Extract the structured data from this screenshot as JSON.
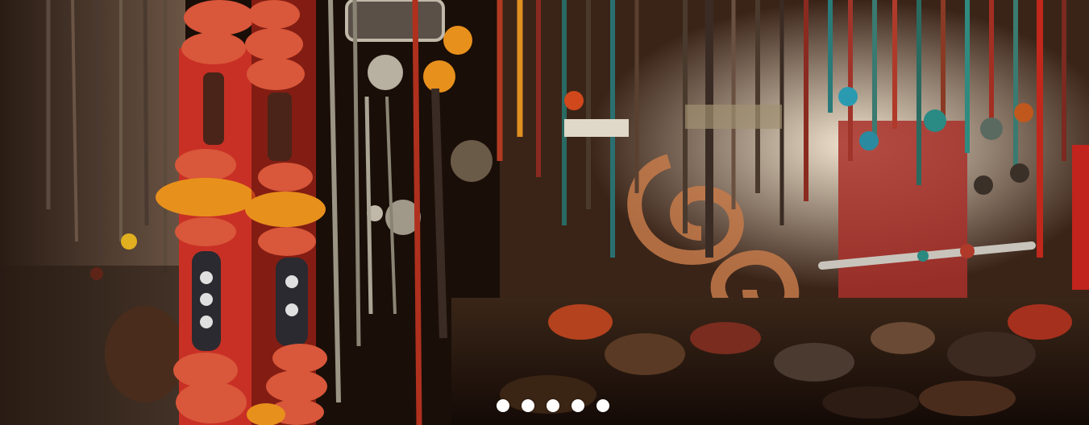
{
  "slider": {
    "slide_count": 5,
    "active_index": 0,
    "dot_color": "#ffffff"
  },
  "scene": {
    "palette": {
      "background": "#1a0e08",
      "bead_red": "#c8321e",
      "bead_orange": "#e8901c",
      "bead_coral": "#d9573a",
      "turquoise": "#1f8a8a",
      "silver": "#b8b0a0",
      "wall": "#e8d8c0",
      "swirl": "#c57a4a",
      "cloth_red": "#b02a24"
    }
  }
}
